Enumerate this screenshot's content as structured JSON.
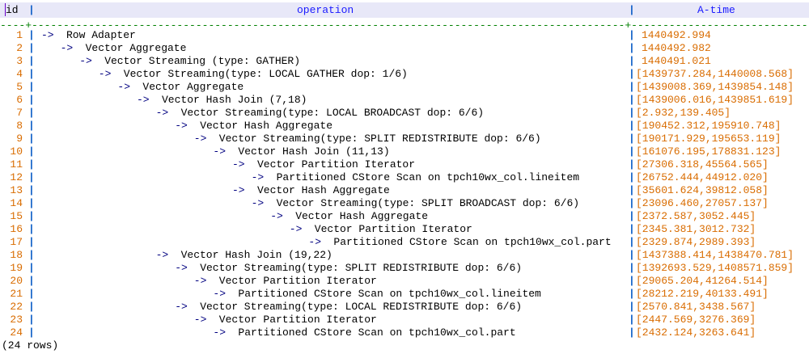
{
  "header": {
    "id": "id",
    "operation": "operation",
    "atime": "A-time"
  },
  "rows": [
    {
      "id": "1",
      "depth": 0,
      "op": "Row Adapter",
      "atime": "1440492.994"
    },
    {
      "id": "2",
      "depth": 1,
      "op": "Vector Aggregate",
      "atime": "1440492.982"
    },
    {
      "id": "3",
      "depth": 2,
      "op": "Vector Streaming (type: GATHER)",
      "atime": "1440491.021"
    },
    {
      "id": "4",
      "depth": 3,
      "op": "Vector Streaming(type: LOCAL GATHER dop: 1/6)",
      "atime": "[1439737.284,1440008.568]"
    },
    {
      "id": "5",
      "depth": 4,
      "op": "Vector Aggregate",
      "atime": "[1439008.369,1439854.148]"
    },
    {
      "id": "6",
      "depth": 5,
      "op": "Vector Hash Join (7,18)",
      "atime": "[1439006.016,1439851.619]"
    },
    {
      "id": "7",
      "depth": 6,
      "op": "Vector Streaming(type: LOCAL BROADCAST dop: 6/6)",
      "atime": "[2.932,139.405]"
    },
    {
      "id": "8",
      "depth": 7,
      "op": "Vector Hash Aggregate",
      "atime": "[190452.312,195910.748]"
    },
    {
      "id": "9",
      "depth": 8,
      "op": "Vector Streaming(type: SPLIT REDISTRIBUTE dop: 6/6)",
      "atime": "[190171.929,195653.119]"
    },
    {
      "id": "10",
      "depth": 9,
      "op": "Vector Hash Join (11,13)",
      "atime": "[161076.195,178831.123]"
    },
    {
      "id": "11",
      "depth": 10,
      "op": "Vector Partition Iterator",
      "atime": "[27306.318,45564.565]"
    },
    {
      "id": "12",
      "depth": 11,
      "op": "Partitioned CStore Scan on tpch10wx_col.lineitem",
      "atime": "[26752.444,44912.020]"
    },
    {
      "id": "13",
      "depth": 10,
      "op": "Vector Hash Aggregate",
      "atime": "[35601.624,39812.058]"
    },
    {
      "id": "14",
      "depth": 11,
      "op": "Vector Streaming(type: SPLIT BROADCAST dop: 6/6)",
      "atime": "[23096.460,27057.137]"
    },
    {
      "id": "15",
      "depth": 12,
      "op": "Vector Hash Aggregate",
      "atime": "[2372.587,3052.445]"
    },
    {
      "id": "16",
      "depth": 13,
      "op": "Vector Partition Iterator",
      "atime": "[2345.381,3012.732]"
    },
    {
      "id": "17",
      "depth": 14,
      "op": "Partitioned CStore Scan on tpch10wx_col.part",
      "atime": "[2329.874,2989.393]"
    },
    {
      "id": "18",
      "depth": 6,
      "op": "Vector Hash Join (19,22)",
      "atime": "[1437388.414,1438470.781]"
    },
    {
      "id": "19",
      "depth": 7,
      "op": "Vector Streaming(type: SPLIT REDISTRIBUTE dop: 6/6)",
      "atime": "[1392693.529,1408571.859]"
    },
    {
      "id": "20",
      "depth": 8,
      "op": "Vector Partition Iterator",
      "atime": "[29065.204,41264.514]"
    },
    {
      "id": "21",
      "depth": 9,
      "op": "Partitioned CStore Scan on tpch10wx_col.lineitem",
      "atime": "[28212.219,40133.491]"
    },
    {
      "id": "22",
      "depth": 7,
      "op": "Vector Streaming(type: LOCAL REDISTRIBUTE dop: 6/6)",
      "atime": "[2570.841,3438.567]"
    },
    {
      "id": "23",
      "depth": 8,
      "op": "Vector Partition Iterator",
      "atime": "[2447.569,3276.369]"
    },
    {
      "id": "24",
      "depth": 9,
      "op": "Partitioned CStore Scan on tpch10wx_col.part",
      "atime": "[2432.124,3263.641]"
    }
  ],
  "footer": "(24 rows)",
  "colors": {
    "keyword": "#1a1aff",
    "number": "#ff8c1a",
    "arrow": "#000080",
    "pipe": "#1060c8",
    "separator": "#008000",
    "header_bg": "#e8e8f8"
  }
}
